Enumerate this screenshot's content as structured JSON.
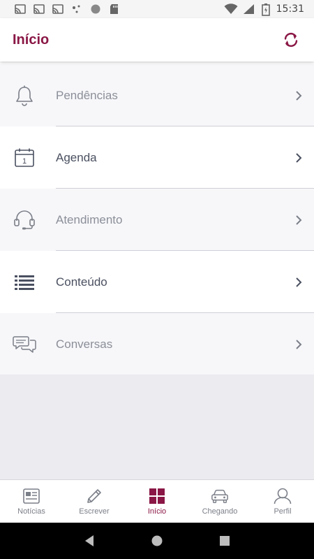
{
  "status_bar": {
    "time": "15:31",
    "icons_left": [
      "cast-icon",
      "cast-icon",
      "cast-icon",
      "dots-icon",
      "circle-icon",
      "sdcard-icon"
    ],
    "icons_right": [
      "wifi-icon",
      "signal-icon",
      "battery-icon"
    ]
  },
  "header": {
    "title": "Início",
    "action_icon": "refresh-icon"
  },
  "menu": {
    "items": [
      {
        "label": "Pendências",
        "icon": "bell-icon"
      },
      {
        "label": "Agenda",
        "icon": "calendar-icon",
        "calendar_day": "1"
      },
      {
        "label": "Atendimento",
        "icon": "headset-icon"
      },
      {
        "label": "Conteúdo",
        "icon": "list-icon"
      },
      {
        "label": "Conversas",
        "icon": "chat-icon"
      }
    ]
  },
  "bottom_nav": {
    "items": [
      {
        "label": "Notícias",
        "icon": "newspaper-icon"
      },
      {
        "label": "Escrever",
        "icon": "pencil-icon"
      },
      {
        "label": "Início",
        "icon": "grid-icon",
        "active": true
      },
      {
        "label": "Chegando",
        "icon": "car-icon"
      },
      {
        "label": "Perfil",
        "icon": "user-icon"
      }
    ]
  },
  "colors": {
    "brand": "#8a1745",
    "text_muted": "#8b8f98",
    "text_dark": "#4a5060",
    "row_alt": "#f7f7fa",
    "empty_bg": "#ebebf0"
  }
}
